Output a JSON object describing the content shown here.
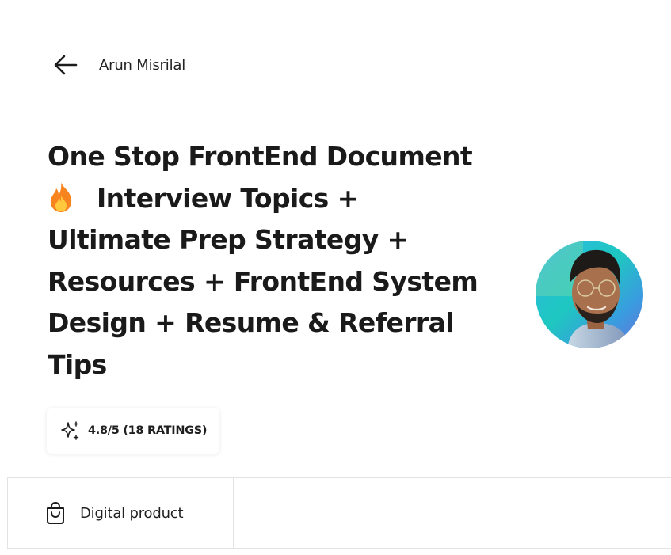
{
  "header": {
    "creator_name": "Arun Misrilal"
  },
  "product": {
    "title_lines": [
      "One Stop FrontEnd Document",
      "Interview Topics +",
      "Ultimate Prep Strategy +",
      "Resources + FrontEnd System",
      "Design + Resume & Referral",
      "Tips"
    ],
    "rating_text": "4.8/5 (18 RATINGS)",
    "type_label": "Digital product"
  },
  "icons": {
    "back": "arrow-left-icon",
    "title_emoji": "fire-icon",
    "rating": "sparkles-icon",
    "product_type": "shopping-bag-icon"
  },
  "colors": {
    "text": "#1a1a1a",
    "border": "#e3e3e3",
    "flame_outer": "#f7841f",
    "flame_inner": "#ffc83d"
  }
}
